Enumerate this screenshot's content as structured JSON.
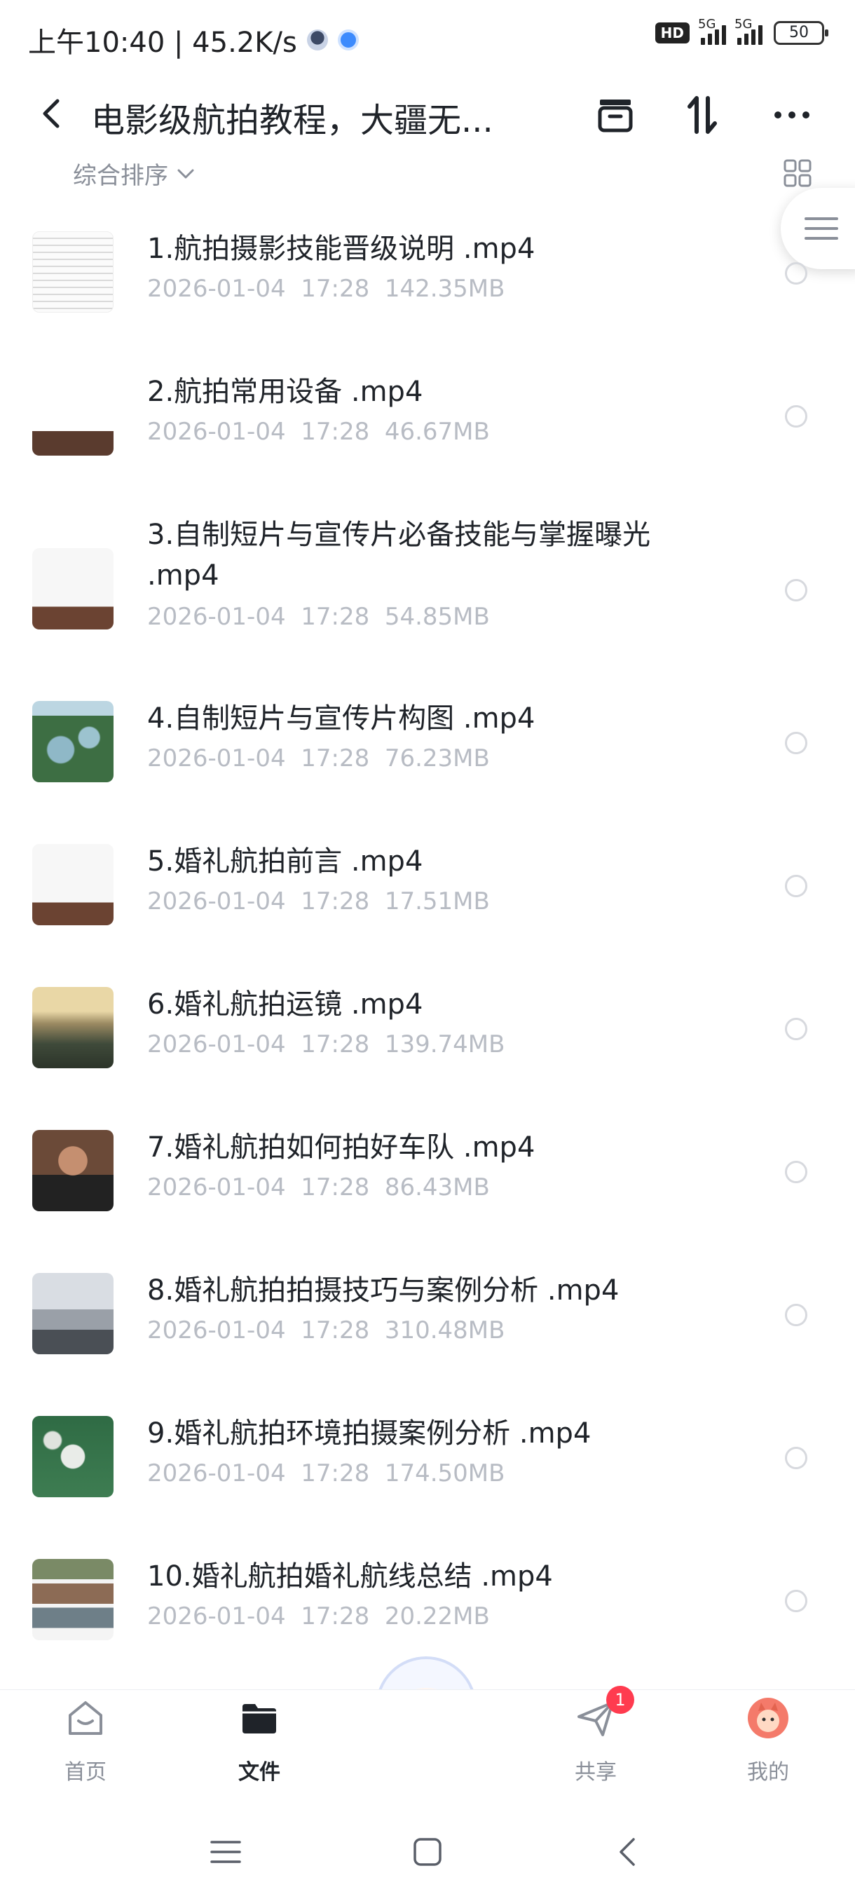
{
  "status_bar": {
    "time_speed": "上午10:40 | 45.2K/s",
    "hd": "HD",
    "sig1": "5G",
    "sig2": "5G",
    "battery": "50"
  },
  "header": {
    "title": "电影级航拍教程，大疆无..."
  },
  "sort": {
    "label": "综合排序"
  },
  "files": [
    {
      "name": "1.航拍摄影技能晋级说明 .mp4",
      "date": "2026-01-04",
      "time": "17:28",
      "size": "142.35MB",
      "thumb": "doc"
    },
    {
      "name": "2.航拍常用设备 .mp4",
      "date": "2026-01-04",
      "time": "17:28",
      "size": "46.67MB",
      "thumb": "slide-devices"
    },
    {
      "name": "3.自制短片与宣传片必备技能与掌握曝光 .mp4",
      "date": "2026-01-04",
      "time": "17:28",
      "size": "54.85MB",
      "thumb": "slide-title"
    },
    {
      "name": "4.自制短片与宣传片构图 .mp4",
      "date": "2026-01-04",
      "time": "17:28",
      "size": "76.23MB",
      "thumb": "aerial-lake"
    },
    {
      "name": "5.婚礼航拍前言 .mp4",
      "date": "2026-01-04",
      "time": "17:28",
      "size": "17.51MB",
      "thumb": "slide-title"
    },
    {
      "name": "6.婚礼航拍运镜 .mp4",
      "date": "2026-01-04",
      "time": "17:28",
      "size": "139.74MB",
      "thumb": "aerial-city"
    },
    {
      "name": "7.婚礼航拍如何拍好车队 .mp4",
      "date": "2026-01-04",
      "time": "17:28",
      "size": "86.43MB",
      "thumb": "person"
    },
    {
      "name": "8.婚礼航拍拍摄技巧与案例分析 .mp4",
      "date": "2026-01-04",
      "time": "17:28",
      "size": "310.48MB",
      "thumb": "street"
    },
    {
      "name": "9.婚礼航拍环境拍摄案例分析 .mp4",
      "date": "2026-01-04",
      "time": "17:28",
      "size": "174.50MB",
      "thumb": "aerial-wedding"
    },
    {
      "name": "10.婚礼航拍婚礼航线总结 .mp4",
      "date": "2026-01-04",
      "time": "17:28",
      "size": "20.22MB",
      "thumb": "collage"
    }
  ],
  "nav": {
    "home": "首页",
    "files": "文件",
    "share": "共享",
    "share_badge": "1",
    "me": "我的"
  }
}
